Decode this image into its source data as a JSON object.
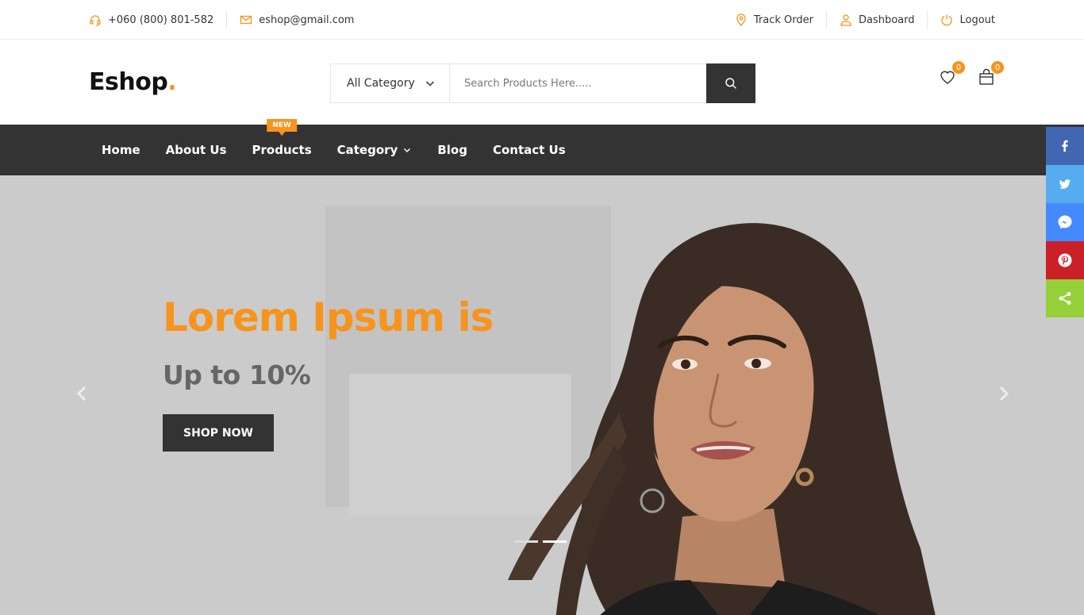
{
  "topbar": {
    "phone": "+060 (800) 801-582",
    "email": "eshop@gmail.com",
    "track_order": "Track Order",
    "dashboard": "Dashboard",
    "logout": "Logout"
  },
  "header": {
    "logo_text": "Eshop",
    "logo_dot": ".",
    "category_selected": "All Category",
    "search_placeholder": "Search Products Here.....",
    "wishlist_count": "0",
    "cart_count": "0"
  },
  "nav": {
    "items": [
      {
        "label": "Home"
      },
      {
        "label": "About Us"
      },
      {
        "label": "Products",
        "badge": "NEW"
      },
      {
        "label": "Category"
      },
      {
        "label": "Blog"
      },
      {
        "label": "Contact Us"
      }
    ]
  },
  "hero": {
    "title": "Lorem Ipsum is",
    "subtitle": "Up to 10%",
    "button": "SHOP NOW"
  },
  "colors": {
    "accent": "#F7941D",
    "dark": "#333333",
    "facebook": "#4267B2",
    "twitter": "#55ACEE",
    "messenger": "#448AFF",
    "pinterest": "#CB2027",
    "share": "#95D03A"
  }
}
